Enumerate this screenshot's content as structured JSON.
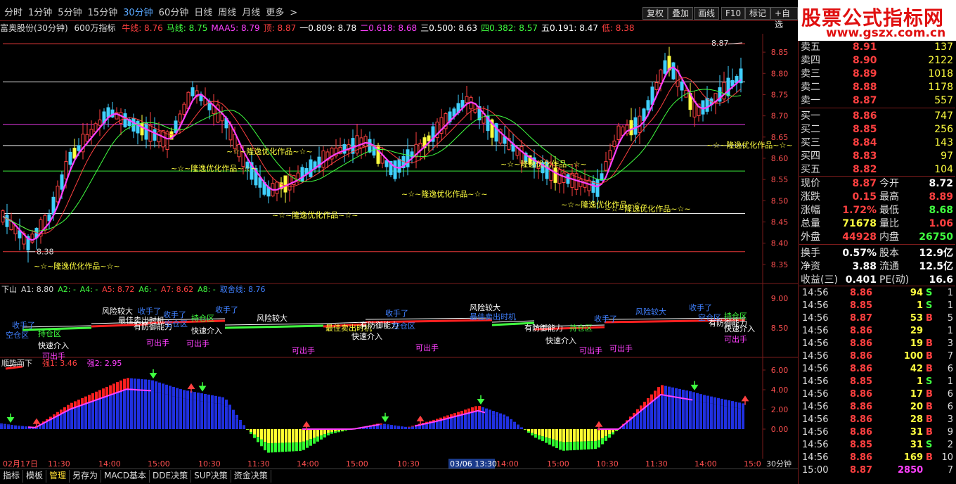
{
  "toolbar": {
    "timeframes": [
      "分时",
      "1分钟",
      "5分钟",
      "15分钟",
      "30分钟",
      "60分钟",
      "日线",
      "周线",
      "月线",
      "更多"
    ],
    "active_timeframe": "30分钟",
    "more_arrow": ">",
    "buttons": [
      "复权",
      "叠加",
      "画线",
      "F10",
      "标记",
      "+自选"
    ]
  },
  "logo": {
    "name": "股票公式指标网",
    "url": "www.gszx.com.cn"
  },
  "infobar": {
    "stock": "富奥股份(30分钟)",
    "indicator": "600万指标",
    "items": [
      {
        "text": "牛线: 8.76",
        "color": "#ff4040"
      },
      {
        "text": "马线: 8.75",
        "color": "#40ff40"
      },
      {
        "text": "MAA5: 8.79",
        "color": "#ff40ff"
      },
      {
        "text": "顶: 8.87",
        "color": "#ff4040"
      },
      {
        "text": "一0.809: 8.78",
        "color": "#ffffff"
      },
      {
        "text": "二0.618: 8.68",
        "color": "#ff40ff"
      },
      {
        "text": "三0.500: 8.63",
        "color": "#ffffff"
      },
      {
        "text": "四0.382: 8.57",
        "color": "#40ff40"
      },
      {
        "text": "五0.191: 8.47",
        "color": "#ffffff"
      },
      {
        "text": "低: 8.38",
        "color": "#ff4040"
      }
    ]
  },
  "chart_data": [
    {
      "type": "candlestick",
      "title": "富奥股份(30分钟) 600万指标",
      "y_ticks": [
        "8.85",
        "8.80",
        "8.75",
        "8.70",
        "8.65",
        "8.60",
        "8.55",
        "8.50",
        "8.45",
        "8.40",
        "8.35"
      ],
      "ylim": [
        8.31,
        8.89
      ],
      "high_label": "8.87",
      "low_label": "8.38",
      "levels": [
        {
          "name": "顶",
          "value": 8.87,
          "color": "#ff4040"
        },
        {
          "name": "一0.809",
          "value": 8.78,
          "color": "#ffffff"
        },
        {
          "name": "二0.618",
          "value": 8.68,
          "color": "#ff40ff"
        },
        {
          "name": "三0.500",
          "value": 8.63,
          "color": "#ffffff"
        },
        {
          "name": "四0.382",
          "value": 8.57,
          "color": "#40ff40"
        },
        {
          "name": "五0.191",
          "value": 8.47,
          "color": "#ffffff"
        },
        {
          "name": "低",
          "value": 8.38,
          "color": "#ff4040"
        }
      ],
      "watermark": "~☆~隆逸优化作品~☆~",
      "watermarks": [
        {
          "x": 48,
          "value": 8.34
        },
        {
          "x": 243,
          "value": 8.57
        },
        {
          "x": 322,
          "value": 8.61
        },
        {
          "x": 387,
          "value": 8.46
        },
        {
          "x": 571,
          "value": 8.51
        },
        {
          "x": 712,
          "value": 8.58
        },
        {
          "x": 798,
          "value": 8.485
        },
        {
          "x": 860,
          "value": 8.475
        },
        {
          "x": 1005,
          "value": 8.625
        }
      ],
      "series": [
        {
          "name": "MAA5",
          "color": "#ff40ff"
        },
        {
          "name": "牛线",
          "color": "#ff4040"
        },
        {
          "name": "马线",
          "color": "#40ff40"
        }
      ]
    },
    {
      "type": "line",
      "title": "下山",
      "legend": [
        {
          "text": "下山",
          "color": "#dddddd"
        },
        {
          "text": "A1: 8.80",
          "color": "#dddddd"
        },
        {
          "text": "A2: -",
          "color": "#40ff40"
        },
        {
          "text": "A4: -",
          "color": "#40ff40"
        },
        {
          "text": "A5: 8.72",
          "color": "#ff4040"
        },
        {
          "text": "A6: -",
          "color": "#40ff40"
        },
        {
          "text": "A7: 8.62",
          "color": "#ff4040"
        },
        {
          "text": "A8: -",
          "color": "#40ff40"
        },
        {
          "text": "取舍线: 8.76",
          "color": "#4080ff"
        }
      ],
      "y_ticks": [
        "9.00",
        "8.50"
      ],
      "annotations": [
        {
          "text": "收手了",
          "color": "#4080ff",
          "x": 17,
          "y": 456
        },
        {
          "text": "空仓区",
          "color": "#4080ff",
          "x": 8,
          "y": 470
        },
        {
          "text": "持仓区",
          "color": "#40ff40",
          "x": 54,
          "y": 468
        },
        {
          "text": "快速介入",
          "color": "#ffffff",
          "x": 54,
          "y": 485
        },
        {
          "text": "可出手",
          "color": "#ff40ff",
          "x": 60,
          "y": 500
        },
        {
          "text": "风险较大",
          "color": "#ffffff",
          "x": 145,
          "y": 436
        },
        {
          "text": "收手了",
          "color": "#4080ff",
          "x": 196,
          "y": 436
        },
        {
          "text": "最佳卖出时机",
          "color": "#ffffff",
          "x": 168,
          "y": 449
        },
        {
          "text": "有防御能力",
          "color": "#ffffff",
          "x": 190,
          "y": 458
        },
        {
          "text": "收手了",
          "color": "#4080ff",
          "x": 232,
          "y": 441
        },
        {
          "text": "空仓区",
          "color": "#4080ff",
          "x": 234,
          "y": 454
        },
        {
          "text": "持仓区",
          "color": "#40ff40",
          "x": 272,
          "y": 446
        },
        {
          "text": "快速介入",
          "color": "#ffffff",
          "x": 272,
          "y": 464
        },
        {
          "text": "可出手",
          "color": "#ff40ff",
          "x": 208,
          "y": 481
        },
        {
          "text": "可出手",
          "color": "#ff40ff",
          "x": 265,
          "y": 482
        },
        {
          "text": "收手了",
          "color": "#4080ff",
          "x": 306,
          "y": 434
        },
        {
          "text": "风险较大",
          "color": "#ffffff",
          "x": 365,
          "y": 446
        },
        {
          "text": "最佳卖出时机",
          "color": "#ffff40",
          "x": 463,
          "y": 460
        },
        {
          "text": "有防御能力",
          "color": "#ffffff",
          "x": 512,
          "y": 456
        },
        {
          "text": "快速介入",
          "color": "#ffffff",
          "x": 500,
          "y": 472
        },
        {
          "text": "收手了",
          "color": "#4080ff",
          "x": 548,
          "y": 439
        },
        {
          "text": "空仓区",
          "color": "#4080ff",
          "x": 558,
          "y": 457
        },
        {
          "text": "可出手",
          "color": "#ff40ff",
          "x": 415,
          "y": 492
        },
        {
          "text": "可出手",
          "color": "#ff40ff",
          "x": 591,
          "y": 488
        },
        {
          "text": "风险较大",
          "color": "#ffffff",
          "x": 668,
          "y": 431
        },
        {
          "text": "最佳卖出时机",
          "color": "#4080ff",
          "x": 668,
          "y": 444
        },
        {
          "text": "有防御能力",
          "color": "#ffffff",
          "x": 746,
          "y": 460
        },
        {
          "text": "持仓区",
          "color": "#40ff40",
          "x": 810,
          "y": 460
        },
        {
          "text": "快速介入",
          "color": "#ffffff",
          "x": 776,
          "y": 478
        },
        {
          "text": "收手了",
          "color": "#4080ff",
          "x": 845,
          "y": 447
        },
        {
          "text": "可出手",
          "color": "#ff40ff",
          "x": 824,
          "y": 492
        },
        {
          "text": "可出手",
          "color": "#ff40ff",
          "x": 867,
          "y": 489
        },
        {
          "text": "风险较大",
          "color": "#4080ff",
          "x": 904,
          "y": 437
        },
        {
          "text": "收手了",
          "color": "#4080ff",
          "x": 980,
          "y": 431
        },
        {
          "text": "空仓区",
          "color": "#4080ff",
          "x": 993,
          "y": 445
        },
        {
          "text": "持仓区",
          "color": "#40ff40",
          "x": 1030,
          "y": 443
        },
        {
          "text": "有防御能力",
          "color": "#ffffff",
          "x": 1008,
          "y": 453
        },
        {
          "text": "快速介入",
          "color": "#ffffff",
          "x": 1030,
          "y": 461
        },
        {
          "text": "可出手",
          "color": "#ff40ff",
          "x": 1030,
          "y": 476
        }
      ]
    },
    {
      "type": "bar",
      "title": "顺势而下",
      "legend": [
        {
          "text": "顺势而下",
          "color": "#dddddd"
        },
        {
          "text": "强1: 3.46",
          "color": "#ff4040"
        },
        {
          "text": "强2: 2.95",
          "color": "#ff40ff"
        }
      ],
      "y_ticks": [
        "6.00",
        "4.00",
        "2.00",
        "0.00"
      ],
      "ylim": [
        -3.0,
        7.0
      ]
    }
  ],
  "x_axis_ticks": [
    "02月17日",
    "11:30",
    "14:00",
    "15:00",
    "10:30",
    "11:30",
    "14:00",
    "15:00",
    "10:30",
    "03/06 13:30",
    "14:00",
    "15:00",
    "10:30",
    "11:30",
    "14:00",
    "15:0"
  ],
  "x_axis_unit": "30分钟",
  "bottom_tabs": [
    "指标",
    "模板",
    "管理",
    "另存为",
    "MACD基本",
    "DDE决策",
    "SUP决策",
    "资金决策"
  ],
  "orderbook": {
    "asks": [
      {
        "label": "卖五",
        "price": "8.91",
        "vol": "137"
      },
      {
        "label": "卖四",
        "price": "8.90",
        "vol": "2122"
      },
      {
        "label": "卖三",
        "price": "8.89",
        "vol": "1018"
      },
      {
        "label": "卖二",
        "price": "8.88",
        "vol": "1178"
      },
      {
        "label": "卖一",
        "price": "8.87",
        "vol": "557"
      }
    ],
    "bids": [
      {
        "label": "买一",
        "price": "8.86",
        "vol": "747"
      },
      {
        "label": "买二",
        "price": "8.85",
        "vol": "256"
      },
      {
        "label": "买三",
        "price": "8.84",
        "vol": "143"
      },
      {
        "label": "买四",
        "price": "8.83",
        "vol": "97"
      },
      {
        "label": "买五",
        "price": "8.82",
        "vol": "104"
      }
    ]
  },
  "stats": [
    {
      "k1": "现价",
      "v1": "8.87",
      "c1": "#ff4040",
      "k2": "今开",
      "v2": "8.72",
      "c2": "#ffffff"
    },
    {
      "k1": "涨跌",
      "v1": "0.15",
      "c1": "#ff4040",
      "k2": "最高",
      "v2": "8.89",
      "c2": "#ff4040"
    },
    {
      "k1": "涨幅",
      "v1": "1.72%",
      "c1": "#ff4040",
      "k2": "最低",
      "v2": "8.68",
      "c2": "#40ff40"
    },
    {
      "k1": "总量",
      "v1": "71678",
      "c1": "#ffff40",
      "k2": "量比",
      "v2": "1.06",
      "c2": "#ff4040"
    },
    {
      "k1": "外盘",
      "v1": "44928",
      "c1": "#ff4040",
      "k2": "内盘",
      "v2": "26750",
      "c2": "#40ff40"
    },
    {
      "k1": "换手",
      "v1": "0.57%",
      "c1": "#ffffff",
      "k2": "股本",
      "v2": "12.9亿",
      "c2": "#ffffff"
    },
    {
      "k1": "净资",
      "v1": "3.88",
      "c1": "#ffffff",
      "k2": "流通",
      "v2": "12.5亿",
      "c2": "#ffffff"
    },
    {
      "k1": "收益(三)",
      "v1": "0.401",
      "c1": "#ffffff",
      "k2": "PE(动)",
      "v2": "16.6",
      "c2": "#ffffff"
    }
  ],
  "ticks": [
    {
      "time": "14:56",
      "price": "8.86",
      "vol": "94",
      "side": "S",
      "n": "1"
    },
    {
      "time": "14:56",
      "price": "8.85",
      "vol": "1",
      "side": "S",
      "n": "1"
    },
    {
      "time": "14:56",
      "price": "8.87",
      "vol": "53",
      "side": "B",
      "n": "5"
    },
    {
      "time": "14:56",
      "price": "8.86",
      "vol": "29",
      "side": "",
      "n": "1"
    },
    {
      "time": "14:56",
      "price": "8.86",
      "vol": "19",
      "side": "B",
      "n": "3"
    },
    {
      "time": "14:56",
      "price": "8.86",
      "vol": "100",
      "side": "B",
      "n": "7"
    },
    {
      "time": "14:56",
      "price": "8.86",
      "vol": "42",
      "side": "B",
      "n": "6"
    },
    {
      "time": "14:56",
      "price": "8.85",
      "vol": "1",
      "side": "S",
      "n": "1"
    },
    {
      "time": "14:56",
      "price": "8.86",
      "vol": "17",
      "side": "B",
      "n": "6"
    },
    {
      "time": "14:56",
      "price": "8.86",
      "vol": "20",
      "side": "B",
      "n": "6"
    },
    {
      "time": "14:56",
      "price": "8.86",
      "vol": "28",
      "side": "B",
      "n": "3"
    },
    {
      "time": "14:56",
      "price": "8.86",
      "vol": "31",
      "side": "B",
      "n": "9"
    },
    {
      "time": "14:56",
      "price": "8.85",
      "vol": "31",
      "side": "S",
      "n": "2"
    },
    {
      "time": "14:56",
      "price": "8.86",
      "vol": "169",
      "side": "B",
      "n": "10"
    },
    {
      "time": "15:00",
      "price": "8.87",
      "vol": "2850",
      "side": "",
      "n": "7"
    }
  ],
  "colors": {
    "up": "#ff4040",
    "down": "#40d0ff",
    "flat": "#ffff40",
    "border": "#7a1b1b",
    "buy": "#ff4040",
    "sell": "#40ff40",
    "hist_up": "#ff2020",
    "hist_blue": "#2030e0",
    "hist_yellow": "#ffff30",
    "hist_green": "#30ff30"
  }
}
